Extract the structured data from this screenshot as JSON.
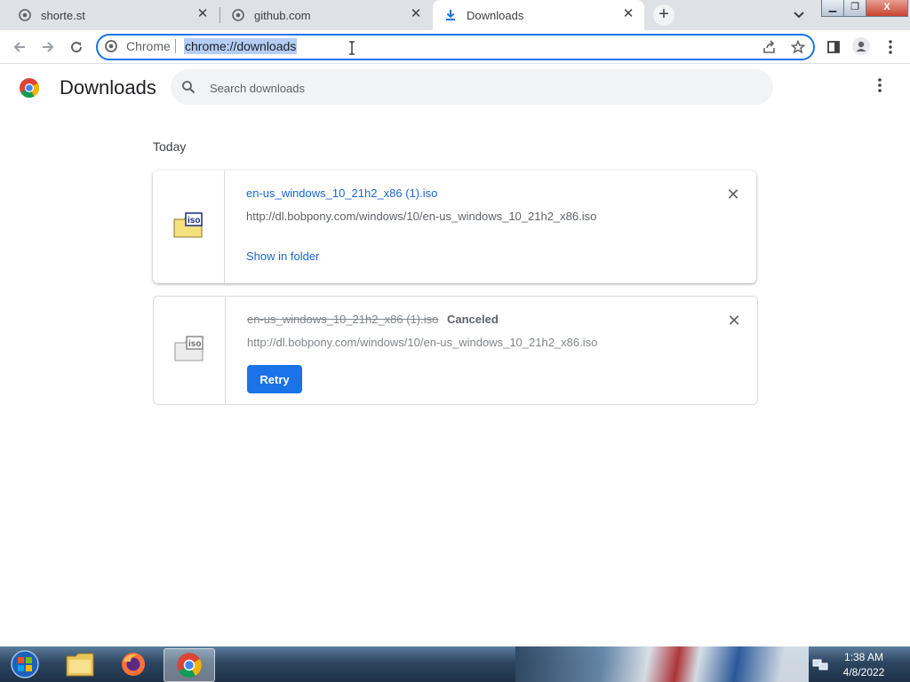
{
  "browser": {
    "tabs": [
      {
        "title": "shorte.st",
        "icon": "globe-icon",
        "active": false
      },
      {
        "title": "github.com",
        "icon": "globe-icon",
        "active": false
      },
      {
        "title": "Downloads",
        "icon": "download-icon",
        "active": true
      }
    ],
    "omnibox": {
      "scheme_label": "Chrome",
      "url": "chrome://downloads"
    }
  },
  "page": {
    "title": "Downloads",
    "search_placeholder": "Search downloads",
    "section_label": "Today"
  },
  "downloads": [
    {
      "filename": "en-us_windows_10_21h2_x86 (1).iso",
      "url": "http://dl.bobpony.com/windows/10/en-us_windows_10_21h2_x86.iso",
      "action": "Show in folder",
      "status": "",
      "icon": "iso-file-icon"
    },
    {
      "filename": "en-us_windows_10_21h2_x86 (1).iso",
      "url": "http://dl.bobpony.com/windows/10/en-us_windows_10_21h2_x86.iso",
      "status": "Canceled",
      "action": "Retry",
      "icon": "iso-file-icon"
    }
  ],
  "taskbar": {
    "apps": [
      "start-orb-icon",
      "file-explorer-icon",
      "firefox-icon",
      "chrome-icon"
    ],
    "time": "1:38 AM",
    "date": "4/8/2022"
  },
  "colors": {
    "accent": "#1a73e8",
    "link": "#1967d2",
    "selection": "#b4cdf5"
  }
}
